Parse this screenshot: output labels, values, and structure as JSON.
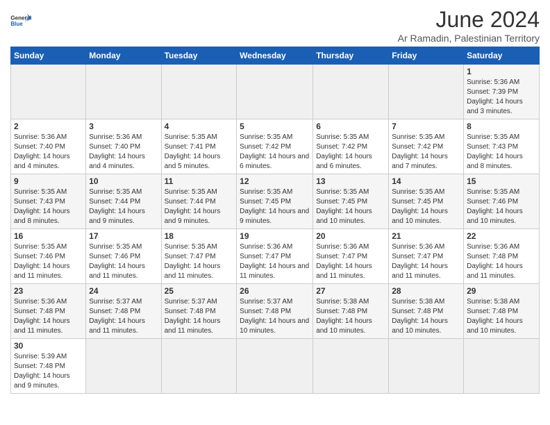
{
  "header": {
    "logo_general": "General",
    "logo_blue": "Blue",
    "month_title": "June 2024",
    "subtitle": "Ar Ramadin, Palestinian Territory"
  },
  "weekdays": [
    "Sunday",
    "Monday",
    "Tuesday",
    "Wednesday",
    "Thursday",
    "Friday",
    "Saturday"
  ],
  "weeks": [
    [
      {
        "day": null
      },
      {
        "day": null
      },
      {
        "day": null
      },
      {
        "day": null
      },
      {
        "day": null
      },
      {
        "day": null
      },
      {
        "day": 1,
        "sunrise": "5:36 AM",
        "sunset": "7:39 PM",
        "daylight": "14 hours and 3 minutes."
      }
    ],
    [
      {
        "day": 2,
        "sunrise": "5:36 AM",
        "sunset": "7:40 PM",
        "daylight": "14 hours and 4 minutes."
      },
      {
        "day": 3,
        "sunrise": "5:36 AM",
        "sunset": "7:40 PM",
        "daylight": "14 hours and 4 minutes."
      },
      {
        "day": 4,
        "sunrise": "5:35 AM",
        "sunset": "7:41 PM",
        "daylight": "14 hours and 5 minutes."
      },
      {
        "day": 5,
        "sunrise": "5:35 AM",
        "sunset": "7:42 PM",
        "daylight": "14 hours and 6 minutes."
      },
      {
        "day": 6,
        "sunrise": "5:35 AM",
        "sunset": "7:42 PM",
        "daylight": "14 hours and 6 minutes."
      },
      {
        "day": 7,
        "sunrise": "5:35 AM",
        "sunset": "7:42 PM",
        "daylight": "14 hours and 7 minutes."
      },
      {
        "day": 8,
        "sunrise": "5:35 AM",
        "sunset": "7:43 PM",
        "daylight": "14 hours and 8 minutes."
      }
    ],
    [
      {
        "day": 9,
        "sunrise": "5:35 AM",
        "sunset": "7:43 PM",
        "daylight": "14 hours and 8 minutes."
      },
      {
        "day": 10,
        "sunrise": "5:35 AM",
        "sunset": "7:44 PM",
        "daylight": "14 hours and 9 minutes."
      },
      {
        "day": 11,
        "sunrise": "5:35 AM",
        "sunset": "7:44 PM",
        "daylight": "14 hours and 9 minutes."
      },
      {
        "day": 12,
        "sunrise": "5:35 AM",
        "sunset": "7:45 PM",
        "daylight": "14 hours and 9 minutes."
      },
      {
        "day": 13,
        "sunrise": "5:35 AM",
        "sunset": "7:45 PM",
        "daylight": "14 hours and 10 minutes."
      },
      {
        "day": 14,
        "sunrise": "5:35 AM",
        "sunset": "7:45 PM",
        "daylight": "14 hours and 10 minutes."
      },
      {
        "day": 15,
        "sunrise": "5:35 AM",
        "sunset": "7:46 PM",
        "daylight": "14 hours and 10 minutes."
      }
    ],
    [
      {
        "day": 16,
        "sunrise": "5:35 AM",
        "sunset": "7:46 PM",
        "daylight": "14 hours and 11 minutes."
      },
      {
        "day": 17,
        "sunrise": "5:35 AM",
        "sunset": "7:46 PM",
        "daylight": "14 hours and 11 minutes."
      },
      {
        "day": 18,
        "sunrise": "5:35 AM",
        "sunset": "7:47 PM",
        "daylight": "14 hours and 11 minutes."
      },
      {
        "day": 19,
        "sunrise": "5:36 AM",
        "sunset": "7:47 PM",
        "daylight": "14 hours and 11 minutes."
      },
      {
        "day": 20,
        "sunrise": "5:36 AM",
        "sunset": "7:47 PM",
        "daylight": "14 hours and 11 minutes."
      },
      {
        "day": 21,
        "sunrise": "5:36 AM",
        "sunset": "7:47 PM",
        "daylight": "14 hours and 11 minutes."
      },
      {
        "day": 22,
        "sunrise": "5:36 AM",
        "sunset": "7:48 PM",
        "daylight": "14 hours and 11 minutes."
      }
    ],
    [
      {
        "day": 23,
        "sunrise": "5:36 AM",
        "sunset": "7:48 PM",
        "daylight": "14 hours and 11 minutes."
      },
      {
        "day": 24,
        "sunrise": "5:37 AM",
        "sunset": "7:48 PM",
        "daylight": "14 hours and 11 minutes."
      },
      {
        "day": 25,
        "sunrise": "5:37 AM",
        "sunset": "7:48 PM",
        "daylight": "14 hours and 11 minutes."
      },
      {
        "day": 26,
        "sunrise": "5:37 AM",
        "sunset": "7:48 PM",
        "daylight": "14 hours and 10 minutes."
      },
      {
        "day": 27,
        "sunrise": "5:38 AM",
        "sunset": "7:48 PM",
        "daylight": "14 hours and 10 minutes."
      },
      {
        "day": 28,
        "sunrise": "5:38 AM",
        "sunset": "7:48 PM",
        "daylight": "14 hours and 10 minutes."
      },
      {
        "day": 29,
        "sunrise": "5:38 AM",
        "sunset": "7:48 PM",
        "daylight": "14 hours and 10 minutes."
      }
    ],
    [
      {
        "day": 30,
        "sunrise": "5:39 AM",
        "sunset": "7:48 PM",
        "daylight": "14 hours and 9 minutes."
      },
      {
        "day": null
      },
      {
        "day": null
      },
      {
        "day": null
      },
      {
        "day": null
      },
      {
        "day": null
      },
      {
        "day": null
      }
    ]
  ],
  "labels": {
    "sunrise": "Sunrise:",
    "sunset": "Sunset:",
    "daylight": "Daylight:"
  }
}
